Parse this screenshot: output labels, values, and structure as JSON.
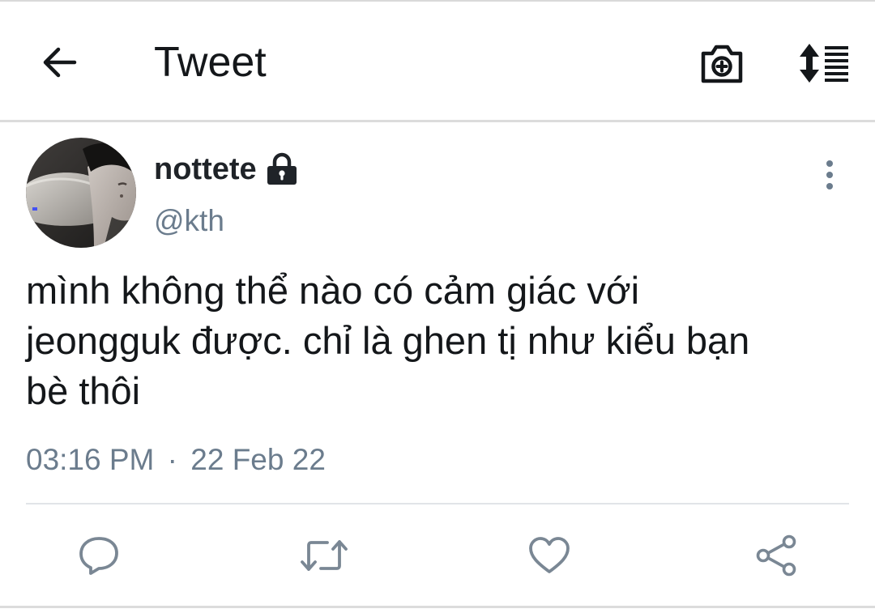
{
  "header": {
    "title": "Tweet",
    "back_icon": "arrow-left-icon",
    "camera_icon": "camera-icon",
    "sort_icon": "sort-icon"
  },
  "tweet": {
    "display_name": "nottete",
    "protected_icon": "lock-icon",
    "handle": "@kth",
    "text": "mình không thể nào có cảm giác với\njeongguk được. chỉ là ghen tị như kiểu bạn\nbè thôi",
    "time": "03:16 PM",
    "separator": "·",
    "date": "22 Feb 22"
  },
  "actions": {
    "reply_icon": "reply-icon",
    "retweet_icon": "retweet-icon",
    "like_icon": "heart-icon",
    "share_icon": "share-icon"
  },
  "colors": {
    "text": "#14171a",
    "muted": "#6b7c8d",
    "action_icon": "#7a8794",
    "divider": "#dcdcdc"
  }
}
